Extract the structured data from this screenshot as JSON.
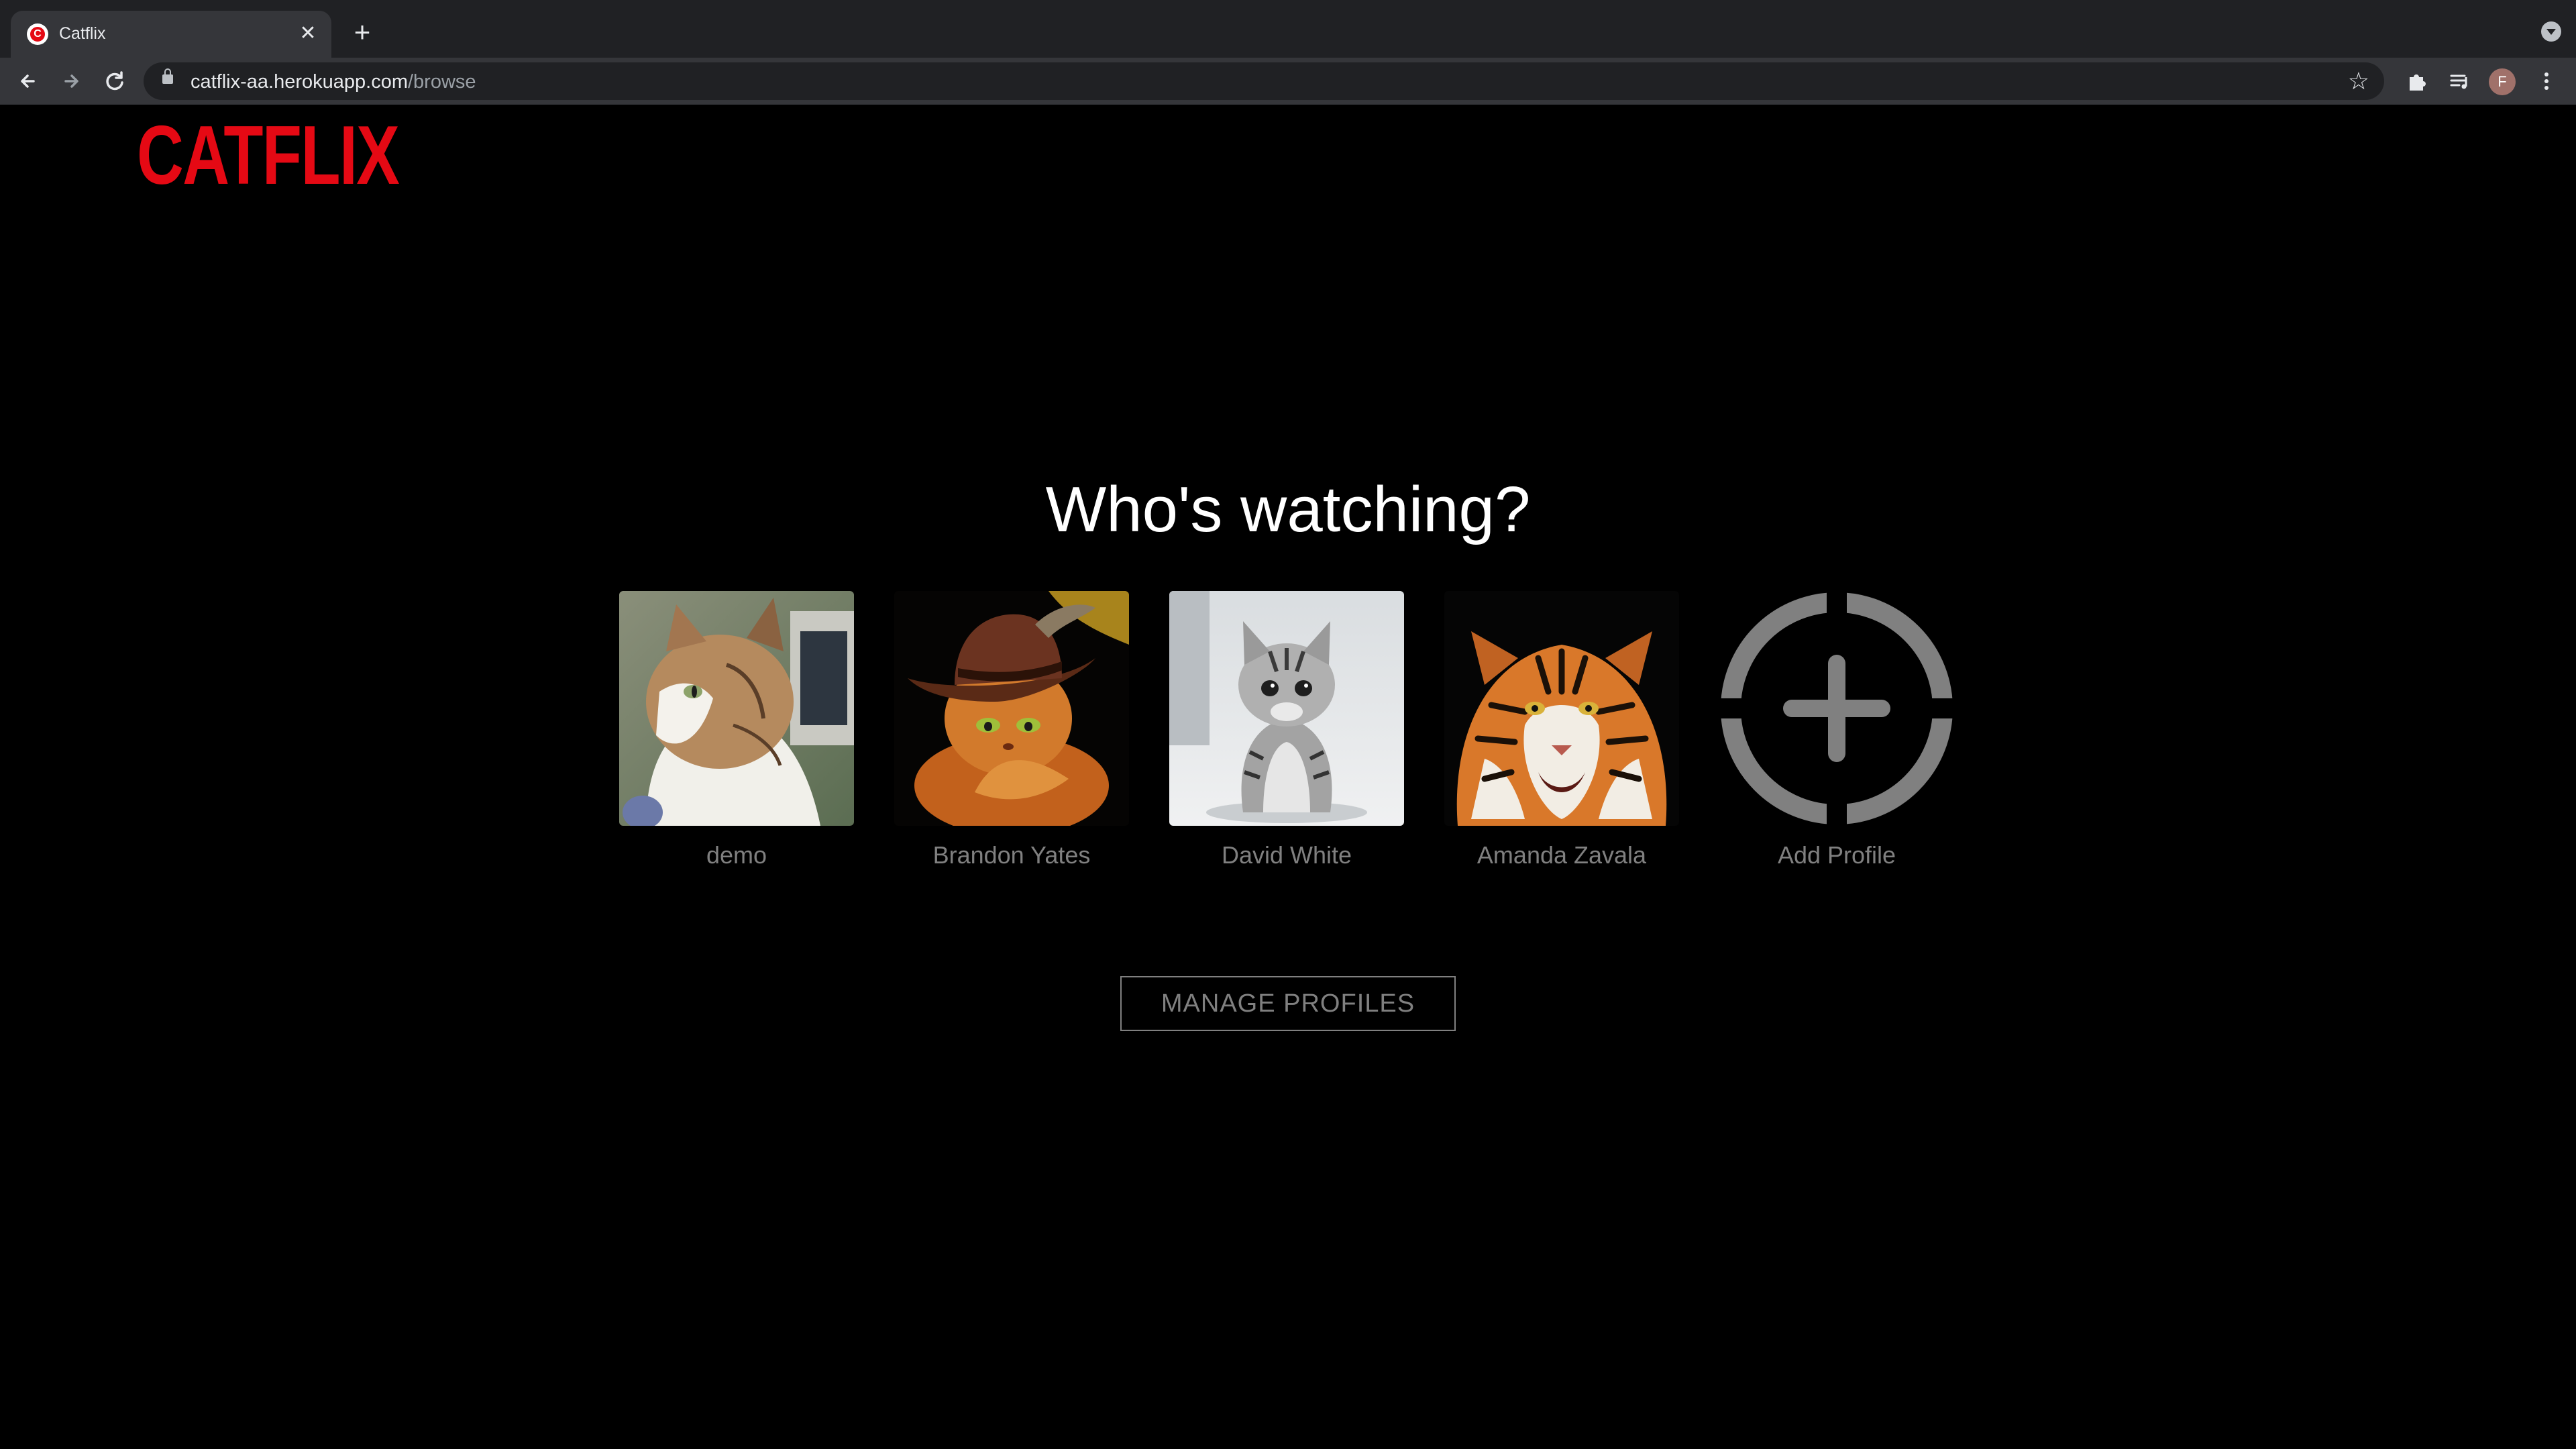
{
  "browser": {
    "tab_title": "Catflix",
    "tab_favicon_letter": "C",
    "close_glyph": "✕",
    "new_tab_glyph": "+",
    "url_host": "catflix-aa.herokuapp.com",
    "url_path": "/browse",
    "profile_initial": "F",
    "icons": [
      "back-arrow-icon",
      "forward-arrow-icon",
      "reload-icon",
      "lock-icon",
      "star-icon",
      "extensions-icon",
      "media-playlist-icon",
      "kebab-menu-icon"
    ]
  },
  "brand": {
    "logo": "CATFLIX",
    "logo_color": "#e50914"
  },
  "main": {
    "heading": "Who's watching?",
    "profiles": [
      {
        "name": "demo"
      },
      {
        "name": "Brandon Yates"
      },
      {
        "name": "David White"
      },
      {
        "name": "Amanda Zavala"
      }
    ],
    "add_profile_label": "Add Profile",
    "manage_button": "MANAGE PROFILES"
  },
  "colors": {
    "background": "#000000",
    "muted_text": "#808080",
    "heading_text": "#ffffff"
  }
}
